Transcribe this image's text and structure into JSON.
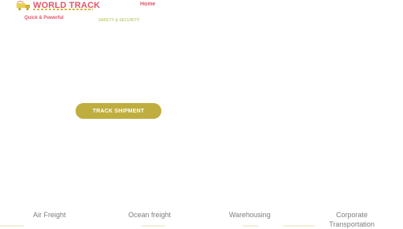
{
  "header": {
    "logo_title": "WORLD TRACK",
    "tagline_primary": "Quick & Powerful",
    "tagline_secondary": "SAFETY & SECURITY",
    "nav": {
      "home_label": "Home"
    }
  },
  "hero": {
    "cta_label": "TRACK SHIPMENT"
  },
  "services": [
    {
      "label": "Air Freight"
    },
    {
      "label": "Ocean freight"
    },
    {
      "label": "Warehousing"
    },
    {
      "label": "Corporate Transportation"
    }
  ],
  "colors": {
    "brand": "#e0566a",
    "accent": "#bfae3f",
    "muted": "#a9b94c"
  }
}
